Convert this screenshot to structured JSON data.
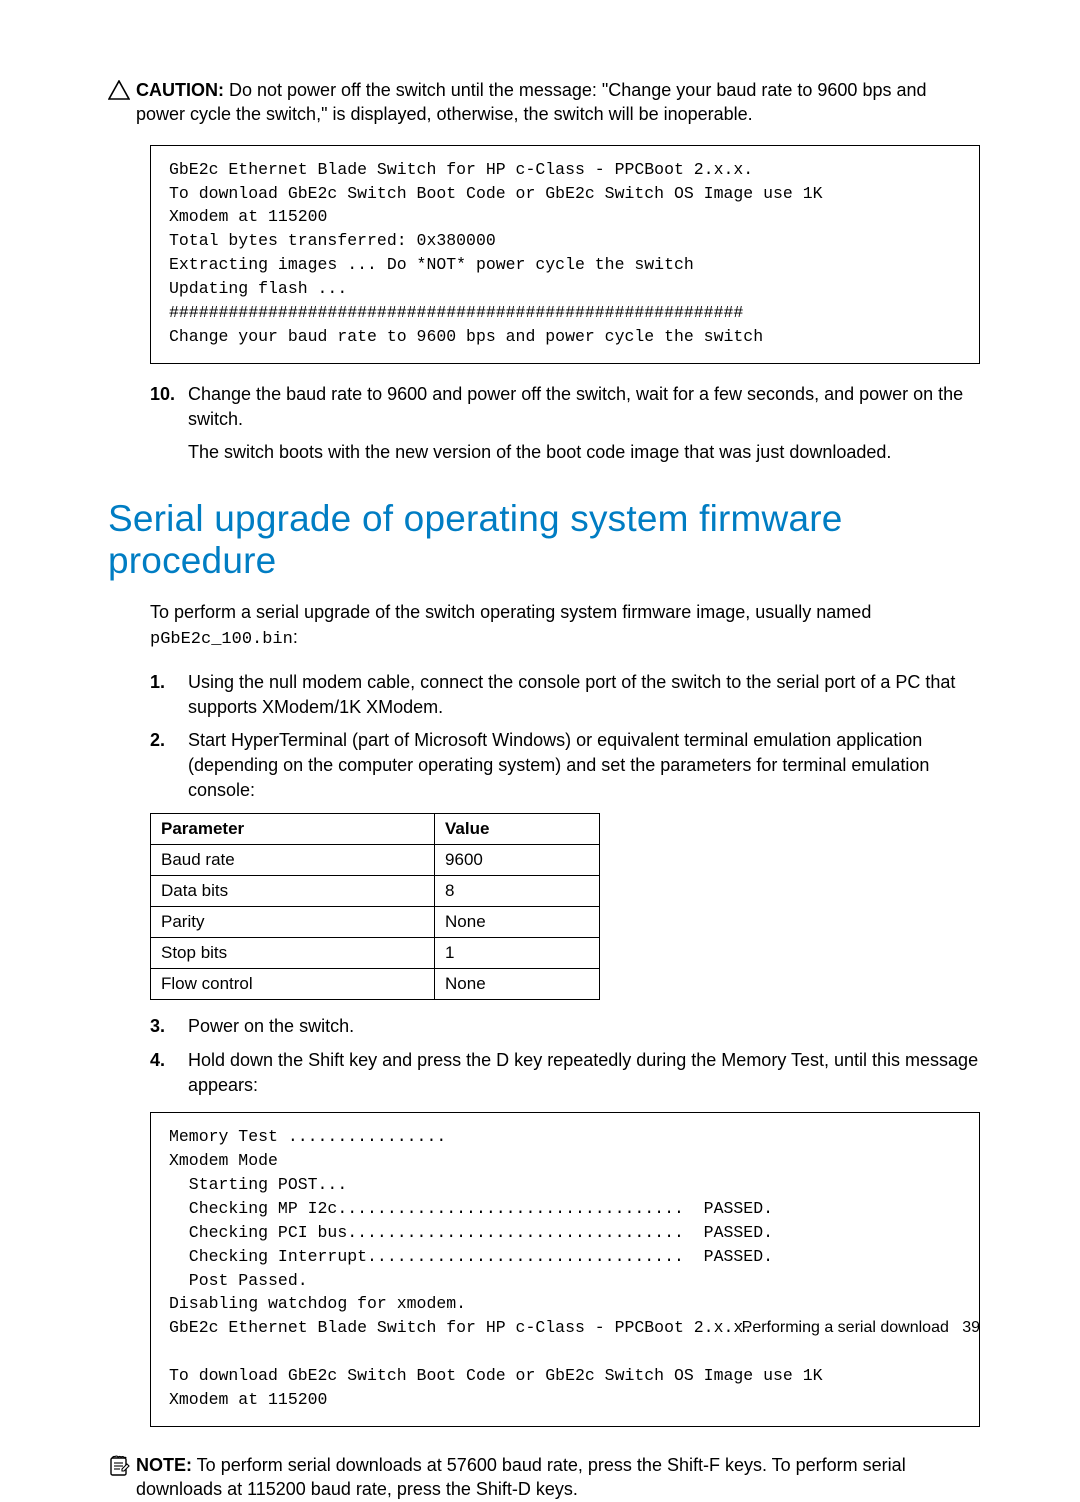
{
  "caution": {
    "label": "CAUTION:",
    "text": " Do not power off the switch until the message: \"Change your baud rate to 9600 bps and power cycle the switch,\" is displayed, otherwise, the switch will be inoperable."
  },
  "code1": "GbE2c Ethernet Blade Switch for HP c-Class - PPCBoot 2.x.x.\nTo download GbE2c Switch Boot Code or GbE2c Switch OS Image use 1K\nXmodem at 115200\nTotal bytes transferred: 0x380000\nExtracting images ... Do *NOT* power cycle the switch\nUpdating flash ...\n##########################################################\nChange your baud rate to 9600 bps and power cycle the switch",
  "step10": {
    "num": "10.",
    "text": "Change the baud rate to 9600 and power off the switch, wait for a few seconds, and power on the switch."
  },
  "step10b": "The switch boots with the new version of the boot code image that was just downloaded.",
  "heading": "Serial upgrade of operating system firmware procedure",
  "intro1": "To perform a serial upgrade of the switch operating system firmware image, usually named ",
  "intro_file": "pGbE2c_100.bin",
  "intro_colon": ":",
  "steps": {
    "s1": {
      "num": "1.",
      "text": "Using the null modem cable, connect the console port of the switch to the serial port of a PC that supports XModem/1K XModem."
    },
    "s2": {
      "num": "2.",
      "text": "Start HyperTerminal (part of Microsoft Windows) or equivalent terminal emulation application (depending on the computer operating system) and set the parameters for terminal emulation console:"
    },
    "s3": {
      "num": "3.",
      "text": "Power on the switch."
    },
    "s4": {
      "num": "4.",
      "text": "Hold down the Shift key and press the D key repeatedly during the Memory Test, until this message appears:"
    }
  },
  "table": {
    "h1": "Parameter",
    "h2": "Value",
    "rows": [
      {
        "p": "Baud rate",
        "v": "9600"
      },
      {
        "p": "Data bits",
        "v": "8"
      },
      {
        "p": "Parity",
        "v": "None"
      },
      {
        "p": "Stop bits",
        "v": "1"
      },
      {
        "p": "Flow control",
        "v": "None"
      }
    ]
  },
  "code2": "Memory Test ................\nXmodem Mode\n  Starting POST...\n  Checking MP I2c...................................  PASSED.\n  Checking PCI bus..................................  PASSED.\n  Checking Interrupt................................  PASSED.\n  Post Passed.\nDisabling watchdog for xmodem.\nGbE2c Ethernet Blade Switch for HP c-Class - PPCBoot 2.x.x.\n\nTo download GbE2c Switch Boot Code or GbE2c Switch OS Image use 1K\nXmodem at 115200",
  "note": {
    "label": "NOTE:",
    "text": " To perform serial downloads at 57600 baud rate, press the Shift-F keys. To perform serial downloads at 115200 baud rate, press the Shift-D keys."
  },
  "footer": {
    "section": "Performing a serial download",
    "page": "39"
  }
}
